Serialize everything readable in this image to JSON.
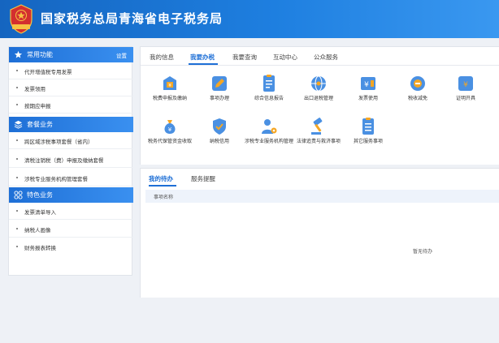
{
  "header": {
    "title": "国家税务总局青海省电子税务局",
    "emblem_text": "中国税务"
  },
  "sidebar": {
    "sections": [
      {
        "title": "常用功能",
        "setting": "设置",
        "items": [
          "代开增值税专用发票",
          "发票领用",
          "按期应申报"
        ]
      },
      {
        "title": "套餐业务",
        "items": [
          "跨区域涉税事项套餐（省内）",
          "清税注销税（费）申报及缴纳套餐",
          "涉税专业服务机构管理套餐"
        ]
      },
      {
        "title": "特色业务",
        "items": [
          "发票清单导入",
          "纳税人画像",
          "财务报表转换"
        ]
      }
    ]
  },
  "main_tabs": [
    "我的信息",
    "我要办税",
    "我要查询",
    "互动中心",
    "公众服务"
  ],
  "active_main_tab": "我要办税",
  "services": [
    {
      "label": "税费申报及缴纳",
      "icon": "tax-declare-icon"
    },
    {
      "label": "事项办理",
      "icon": "pencil-icon"
    },
    {
      "label": "综合信息报告",
      "icon": "document-icon"
    },
    {
      "label": "出口退税管理",
      "icon": "globe-icon"
    },
    {
      "label": "发票使用",
      "icon": "invoice-icon"
    },
    {
      "label": "税收减免",
      "icon": "tax-relief-icon"
    },
    {
      "label": "证明开具",
      "icon": "certificate-icon"
    },
    {
      "label": "税务代保管资金收取",
      "icon": "money-bag-icon"
    },
    {
      "label": "纳税信用",
      "icon": "shield-icon"
    },
    {
      "label": "涉税专业服务机构管理",
      "icon": "person-gear-icon"
    },
    {
      "label": "法律追责与救济事项",
      "icon": "gavel-icon"
    },
    {
      "label": "其它服务事项",
      "icon": "list-icon"
    }
  ],
  "bottom_tabs": [
    "我的待办",
    "服务提醒"
  ],
  "active_bottom_tab": "我的待办",
  "table": {
    "header": "事项名称",
    "empty_text": "暂无待办"
  },
  "colors": {
    "primary": "#1e6fd6",
    "header_start": "#1565c0",
    "header_end": "#3a98f0",
    "page_bg": "#eef1f6"
  }
}
